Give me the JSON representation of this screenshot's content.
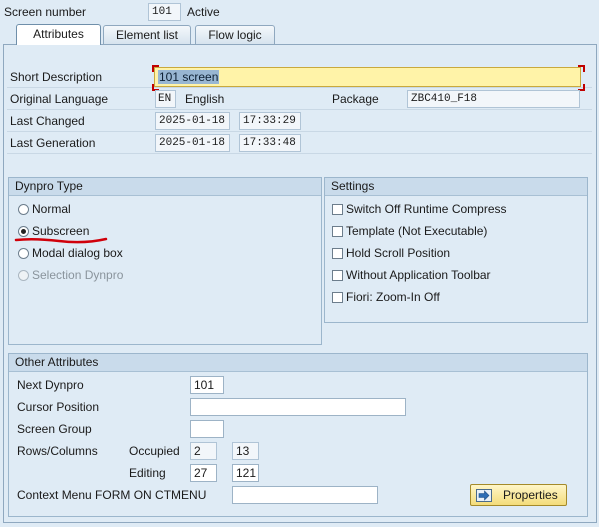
{
  "header": {
    "screen_number_label": "Screen number",
    "screen_number_value": "101",
    "status": "Active"
  },
  "tabs": [
    {
      "label": "Attributes",
      "active": true
    },
    {
      "label": "Element list",
      "active": false
    },
    {
      "label": "Flow logic",
      "active": false
    }
  ],
  "attributes": {
    "short_description_label": "Short Description",
    "short_description_value": "101 screen",
    "original_language_label": "Original Language",
    "language_code": "EN",
    "language_name": "English",
    "package_label": "Package",
    "package_value": "ZBC410_F18",
    "last_changed_label": "Last Changed",
    "last_changed_date": "2025-01-18",
    "last_changed_time": "17:33:29",
    "last_generation_label": "Last Generation",
    "last_generation_date": "2025-01-18",
    "last_generation_time": "17:33:48"
  },
  "dynpro_type": {
    "title": "Dynpro Type",
    "options": [
      {
        "label": "Normal",
        "selected": false,
        "enabled": true
      },
      {
        "label": "Subscreen",
        "selected": true,
        "enabled": true
      },
      {
        "label": "Modal dialog box",
        "selected": false,
        "enabled": true
      },
      {
        "label": "Selection Dynpro",
        "selected": false,
        "enabled": false
      }
    ]
  },
  "settings": {
    "title": "Settings",
    "options": [
      {
        "label": "Switch Off Runtime Compress",
        "checked": false
      },
      {
        "label": "Template (Not Executable)",
        "checked": false
      },
      {
        "label": "Hold Scroll Position",
        "checked": false
      },
      {
        "label": "Without Application Toolbar",
        "checked": false
      },
      {
        "label": "Fiori: Zoom-In Off",
        "checked": false
      }
    ]
  },
  "other_attributes": {
    "title": "Other Attributes",
    "next_dynpro_label": "Next Dynpro",
    "next_dynpro_value": "101",
    "cursor_position_label": "Cursor Position",
    "cursor_position_value": "",
    "screen_group_label": "Screen Group",
    "screen_group_value": "",
    "rows_columns_label": "Rows/Columns",
    "occupied_label": "Occupied",
    "occupied_rows": "2",
    "occupied_cols": "13",
    "editing_label": "Editing",
    "editing_rows": "27",
    "editing_cols": "121",
    "context_menu_label": "Context Menu FORM ON CTMENU",
    "context_menu_value": "",
    "properties_button": "Properties"
  },
  "colors": {
    "background": "#dfebf5",
    "highlight_field": "#fff3a8",
    "annotation_underline": "#d0000a"
  },
  "icons": {
    "properties_button_icon": "arrow-right-icon"
  }
}
